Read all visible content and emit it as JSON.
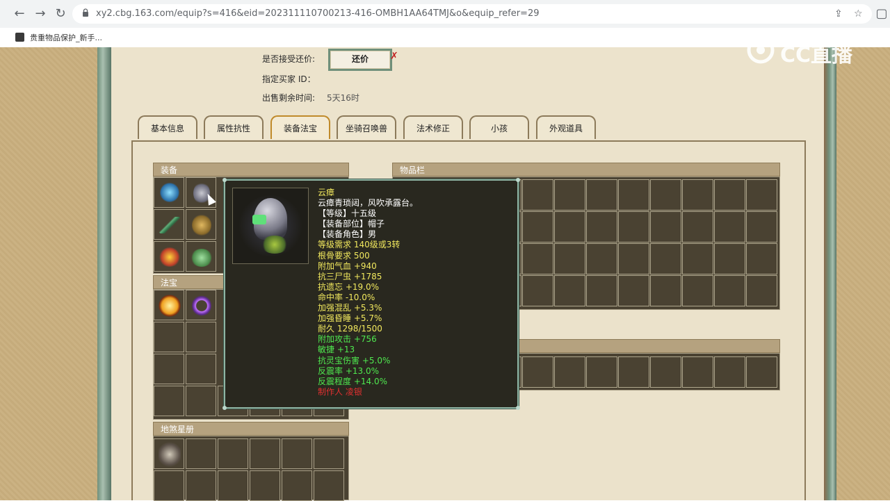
{
  "browser": {
    "url": "xy2.cbg.163.com/equip?s=416&eid=202311110700213-416-OMBH1AA64TMJ&o&equip_refer=29",
    "bookmark": "贵重物品保护_新手..."
  },
  "info": {
    "counter_label": "是否接受还价:",
    "counter_button": "还价",
    "buyer_label": "指定买家 ID：",
    "time_label": "出售剩余时间:",
    "time_value": "5天16时"
  },
  "tabs": [
    "基本信息",
    "属性抗性",
    "装备法宝",
    "坐骑召唤兽",
    "法术修正",
    "小孩",
    "外观道具"
  ],
  "sections": {
    "equipment": "装备",
    "treasure": "法宝",
    "star_book": "地煞星册",
    "inventory": "物品栏"
  },
  "tooltip": {
    "name": "云瘴",
    "desc": "云瘴青琐闼，风吹承露台。",
    "lines": [
      {
        "text": "【等级】十五级",
        "color": "white"
      },
      {
        "text": "【装备部位】帽子",
        "color": "white"
      },
      {
        "text": "【装备角色】男",
        "color": "white"
      },
      {
        "text": "等级需求 140级或3转",
        "color": "yellow"
      },
      {
        "text": "根骨要求 500",
        "color": "yellow"
      },
      {
        "text": "附加气血 +940",
        "color": "yellow"
      },
      {
        "text": "抗三尸虫 +1785",
        "color": "yellow"
      },
      {
        "text": "抗遗忘 +19.0%",
        "color": "yellow"
      },
      {
        "text": "命中率 -10.0%",
        "color": "yellow"
      },
      {
        "text": "加强混乱 +5.3%",
        "color": "yellow"
      },
      {
        "text": "加强昏睡 +5.7%",
        "color": "yellow"
      },
      {
        "text": "耐久 1298/1500",
        "color": "yellow"
      },
      {
        "text": "附加攻击 +756",
        "color": "green"
      },
      {
        "text": "敏捷 +13",
        "color": "green"
      },
      {
        "text": "抗灵宝伤害 +5.0%",
        "color": "green"
      },
      {
        "text": "反震率 +13.0%",
        "color": "green"
      },
      {
        "text": "反震程度 +14.0%",
        "color": "green"
      },
      {
        "text": "制作人 凌银",
        "color": "red"
      }
    ]
  },
  "watermark": "CC直播"
}
